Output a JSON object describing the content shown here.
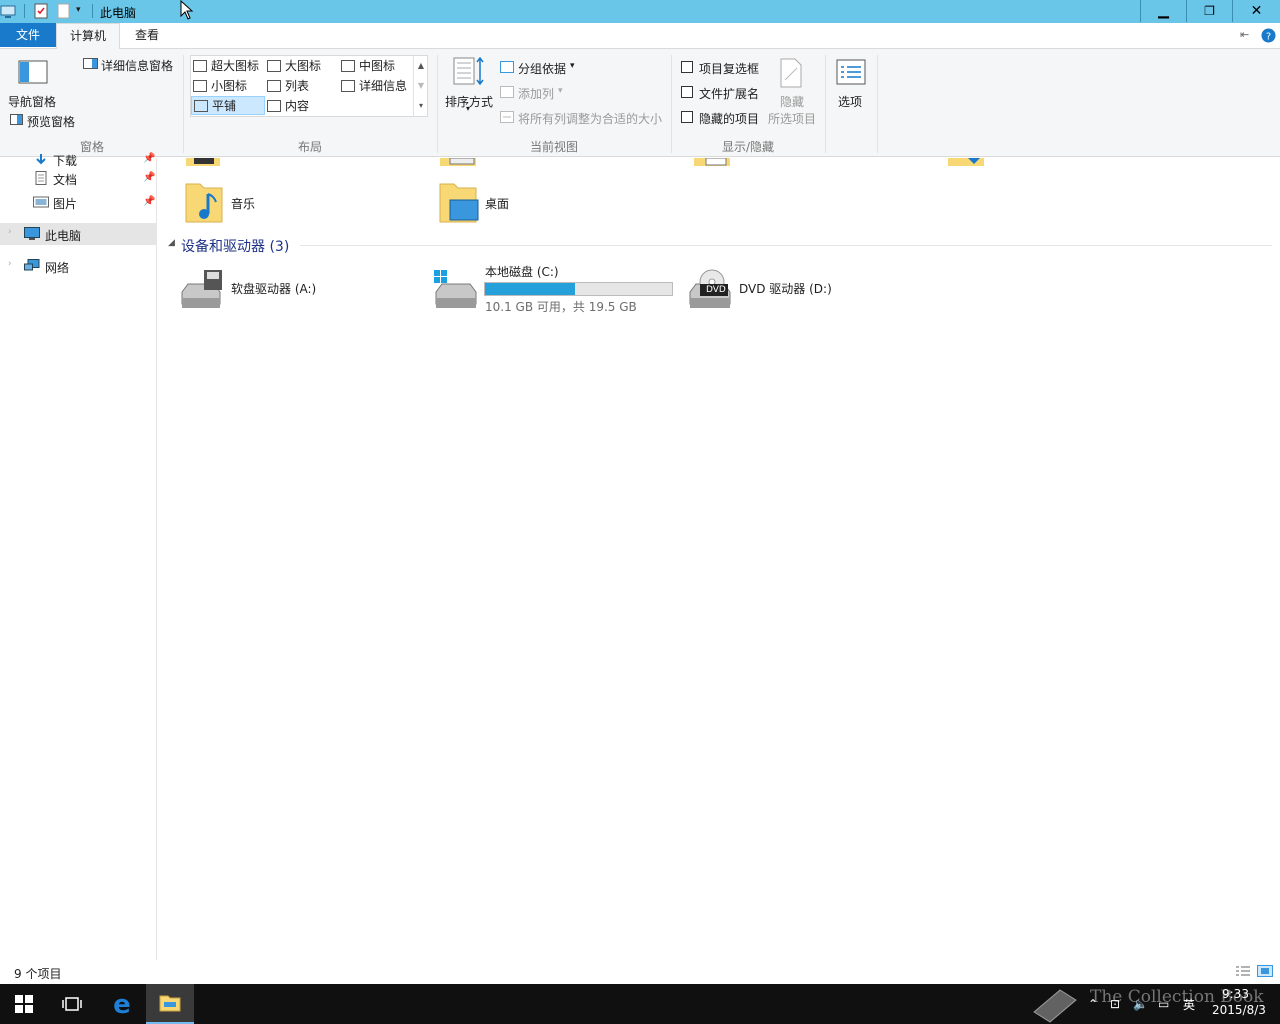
{
  "titlebar": {
    "title": "此电脑"
  },
  "tabs": {
    "file": "文件",
    "computer": "计算机",
    "view": "查看"
  },
  "ribbon": {
    "panes": {
      "nav_pane": "导航窗格",
      "preview_pane": "预览窗格",
      "details_pane": "详细信息窗格",
      "group_label": "窗格"
    },
    "layout": {
      "items": [
        "超大图标",
        "大图标",
        "中图标",
        "小图标",
        "列表",
        "详细信息",
        "平铺",
        "内容"
      ],
      "selected": "平铺",
      "group_label": "布局"
    },
    "current_view": {
      "sort_by": "排序方式",
      "group_by": "分组依据",
      "add_columns": "添加列",
      "size_columns": "将所有列调整为合适的大小",
      "group_label": "当前视图"
    },
    "show_hide": {
      "item_checkboxes": "项目复选框",
      "file_extensions": "文件扩展名",
      "hidden_items": "隐藏的项目",
      "hide_selected_1": "隐藏",
      "hide_selected_2": "所选项目",
      "group_label": "显示/隐藏"
    },
    "options": "选项"
  },
  "nav": {
    "items": [
      {
        "label": "下载",
        "pinned": true
      },
      {
        "label": "文档",
        "pinned": true
      },
      {
        "label": "图片",
        "pinned": true
      },
      {
        "label": "此电脑",
        "selected": true
      },
      {
        "label": "网络"
      }
    ]
  },
  "content": {
    "folders": [
      "音乐",
      "桌面"
    ],
    "group_header": "设备和驱动器 (3)",
    "drives": [
      {
        "label": "软盘驱动器 (A:)"
      },
      {
        "label": "本地磁盘 (C:)",
        "free": "10.1 GB 可用，共 19.5 GB",
        "used_fraction": 0.48
      },
      {
        "label": "DVD 驱动器 (D:)",
        "badge": "DVD"
      }
    ]
  },
  "statusbar": {
    "count": "9 个项目"
  },
  "taskbar": {
    "time": "9:33",
    "date": "2015/8/3",
    "ime": "英",
    "watermark": "The Collection Book"
  }
}
